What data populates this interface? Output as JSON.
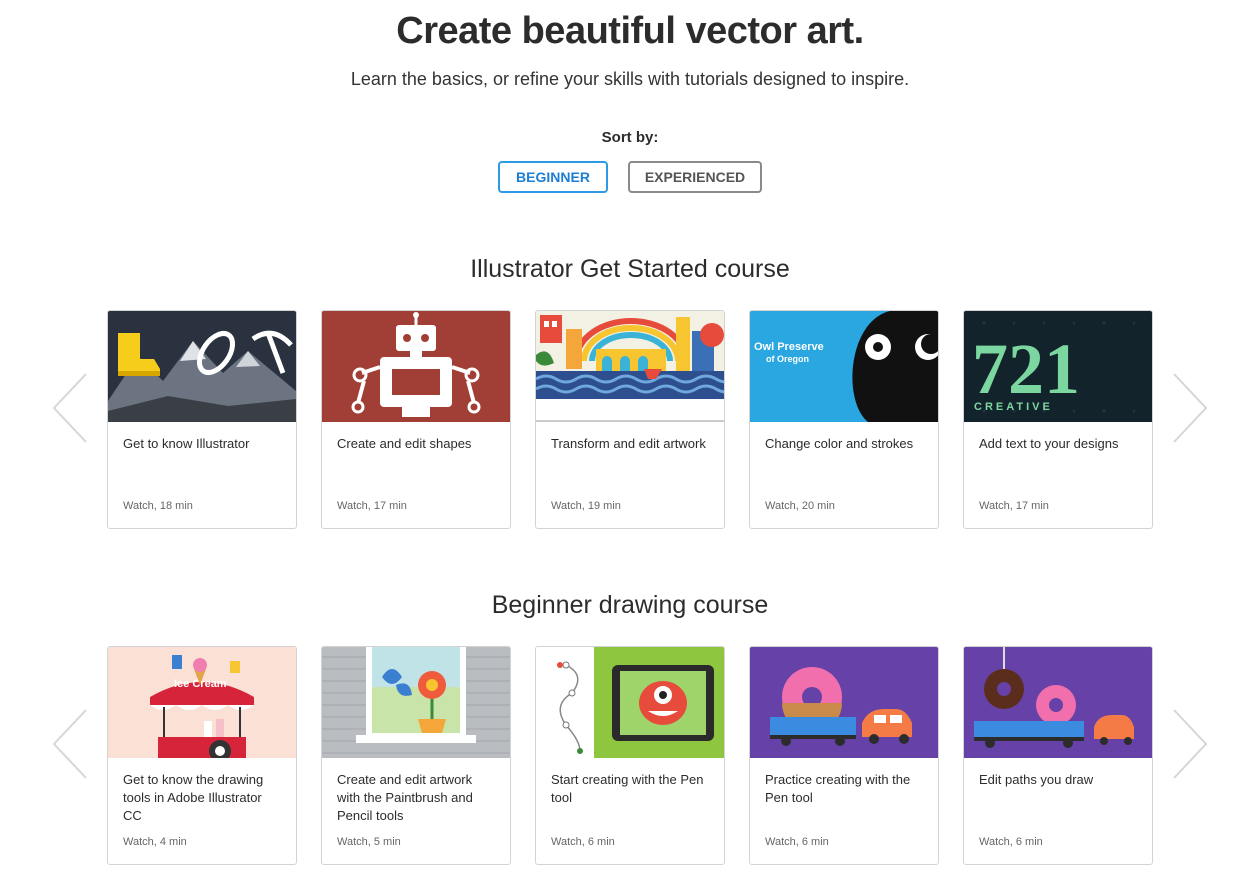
{
  "hero": {
    "title": "Create beautiful vector art.",
    "subtitle": "Learn the basics, or refine your skills with tutorials designed to inspire."
  },
  "sort": {
    "label": "Sort by:",
    "options": [
      {
        "label": "BEGINNER",
        "selected": true
      },
      {
        "label": "EXPERIENCED",
        "selected": false
      }
    ]
  },
  "colors": {
    "accent": "#2d9ae6",
    "text": "#2c2c2c",
    "border": "#d3d3d3"
  },
  "sections": [
    {
      "title": "Illustrator Get Started course",
      "cards": [
        {
          "title": "Get to know Illustrator",
          "meta": "Watch, 18 min",
          "thumb": "mountain-boot-carabiner"
        },
        {
          "title": "Create and edit shapes",
          "meta": "Watch, 17 min",
          "thumb": "robot"
        },
        {
          "title": "Transform and edit artwork",
          "meta": "Watch, 19 min",
          "thumb": "colorful-city-sea"
        },
        {
          "title": "Change color and strokes",
          "meta": "Watch, 20 min",
          "thumb": "owl-preserve-logo",
          "thumb_text": [
            "Owl Preserve",
            "of Oregon"
          ]
        },
        {
          "title": "Add text to your designs",
          "meta": "Watch, 17 min",
          "thumb": "721-creative-logo",
          "thumb_text": [
            "721",
            "CREATIVE"
          ]
        }
      ]
    },
    {
      "title": "Beginner drawing course",
      "cards": [
        {
          "title": "Get to know the drawing tools in Adobe Illustrator CC",
          "meta": "Watch, 4 min",
          "thumb": "ice-cream-cart",
          "thumb_text": [
            "Ice Cream"
          ]
        },
        {
          "title": "Create and edit artwork with the Paintbrush and Pencil tools",
          "meta": "Watch, 5 min",
          "thumb": "window-flower-butterfly"
        },
        {
          "title": "Start creating with the Pen tool",
          "meta": "Watch, 6 min",
          "thumb": "pen-path-monster-tablet"
        },
        {
          "title": "Practice creating with the Pen tool",
          "meta": "Watch, 6 min",
          "thumb": "donut-truck-car"
        },
        {
          "title": "Edit paths you draw",
          "meta": "Watch, 6 min",
          "thumb": "donut-crane-truck"
        }
      ]
    }
  ],
  "icons": {
    "prev": "chevron-left-icon",
    "next": "chevron-right-icon"
  }
}
